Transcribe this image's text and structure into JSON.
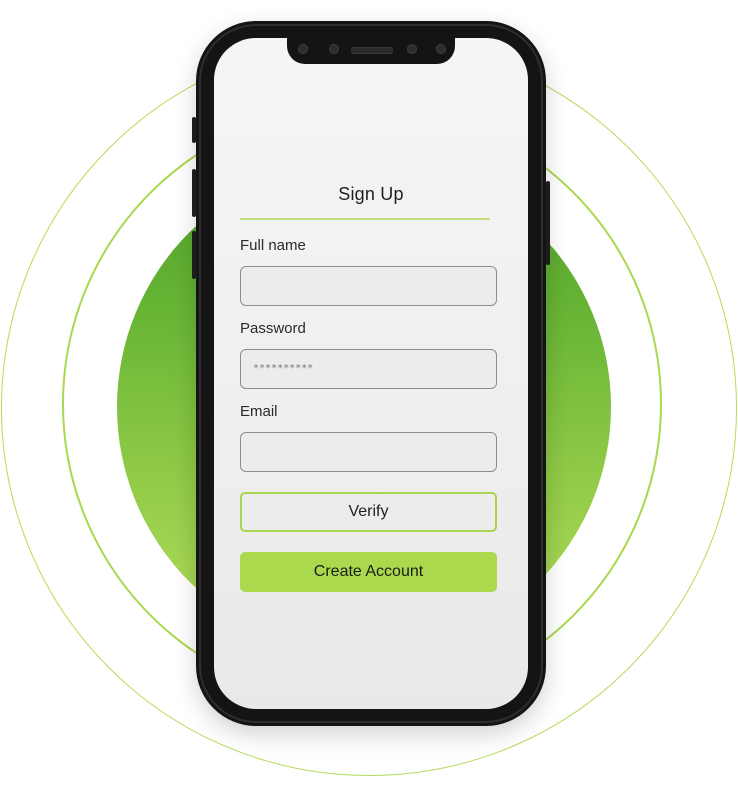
{
  "form": {
    "title": "Sign Up",
    "full_name": {
      "label": "Full name",
      "value": ""
    },
    "password": {
      "label": "Password",
      "value": "**********"
    },
    "email": {
      "label": "Email",
      "value": ""
    },
    "verify_label": "Verify",
    "create_label": "Create Account"
  },
  "colors": {
    "accent": "#abd94d",
    "ring": "#b3dc57",
    "disc_top": "#4fa126",
    "disc_bottom": "#b6df5d",
    "phone_body": "#141414"
  }
}
